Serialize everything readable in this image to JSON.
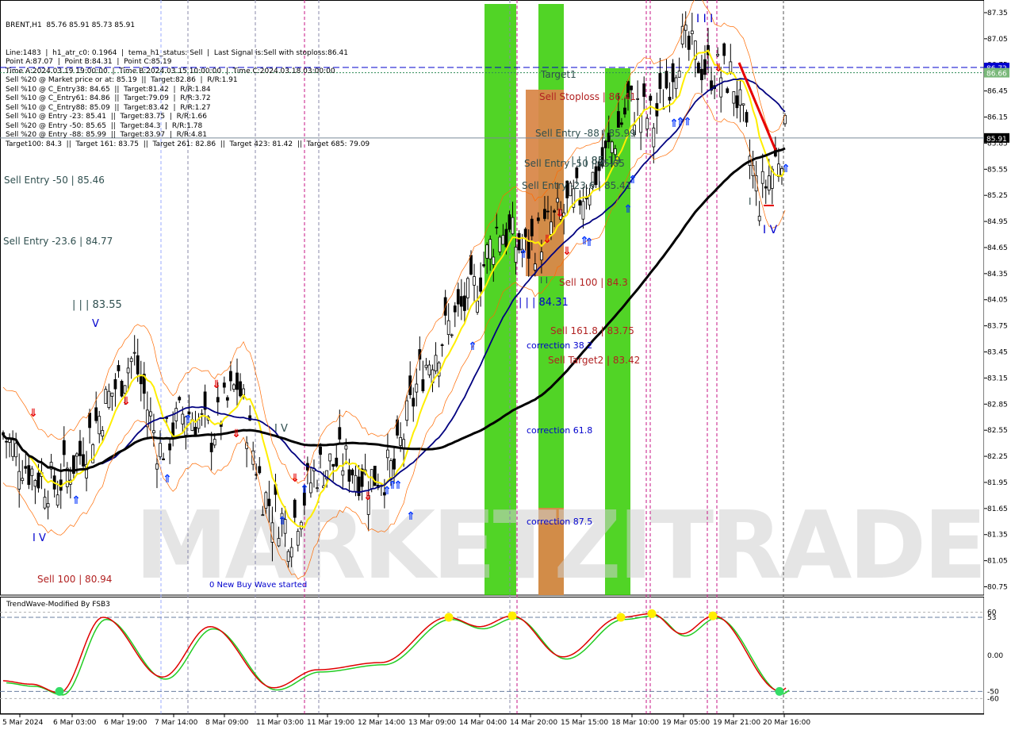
{
  "header": {
    "symbol_line": "BRENT,H1  85.76 85.91 85.73 85.91",
    "info_lines": [
      "Line:1483  |  h1_atr_c0: 0.1964  |  tema_h1_status: Sell  |  Last Signal is:Sell with stoploss:86.41",
      "Point A:87.07  |  Point B:84.31  |  Point C:85.19",
      "Time A:2024.03.19 19:00:00  |  Time B:2024.03.15 10:00:00  |  Time C:2024.03.18 03:00:00",
      "Sell %20 @ Market price or at: 85.19  ||  Target:82.86  |  R/R:1.91",
      "Sell %10 @ C_Entry38: 84.65  ||  Target:81.42  |  R/R:1.84",
      "Sell %10 @ C_Entry61: 84.86  ||  Target:79.09  |  R/R:3.72",
      "Sell %10 @ C_Entry88: 85.09  ||  Target:83.42  |  R/R:1.27",
      "Sell %10 @ Entry -23: 85.41  ||  Target:83.75  |  R/R:1.66",
      "Sell %20 @ Entry -50: 85.65  ||  Target:84.3  |  R/R:1.78",
      "Sell %20 @ Entry -88: 85.99  ||  Target:83.97  |  R/R:4.81",
      "Target100: 84.3  ||  Target 161: 83.75  ||  Target 261: 82.86  ||  Target 423: 81.42  ||  Target 685: 79.09"
    ]
  },
  "watermark": "MARKETZITRADE",
  "indicator_title": "TrendWave-Modified By FSB3",
  "colors": {
    "background": "#ffffff",
    "up_candle": "#000000",
    "yellow_line": "#ffee00",
    "navy_line": "#000080",
    "black_line": "#000000",
    "green_zone": "#33cc00",
    "orange_zone": "#d9884a",
    "label_dark": "#2f4f4f",
    "label_red": "#b22222",
    "label_blue": "#0000cd",
    "red_arrow": "#e60000",
    "blue_arrow": "#0033ff",
    "price_tag_blue": "#0000cd",
    "price_tag_green": "#2e8b57"
  },
  "chart_data": {
    "type": "candlestick",
    "symbol": "BRENT",
    "timeframe": "H1",
    "ylim": [
      80.7,
      87.45
    ],
    "y_ticks": [
      87.35,
      87.05,
      86.75,
      86.45,
      86.15,
      85.85,
      85.55,
      85.25,
      84.95,
      84.65,
      84.35,
      84.05,
      83.75,
      83.45,
      83.15,
      82.85,
      82.55,
      82.25,
      81.95,
      81.65,
      81.35,
      81.05,
      80.75
    ],
    "x_ticks": [
      "5 Mar 2024",
      "6 Mar 03:00",
      "6 Mar 19:00",
      "7 Mar 14:00",
      "8 Mar 09:00",
      "11 Mar 03:00",
      "11 Mar 19:00",
      "12 Mar 14:00",
      "13 Mar 09:00",
      "14 Mar 04:00",
      "14 Mar 20:00",
      "15 Mar 15:00",
      "18 Mar 10:00",
      "19 Mar 05:00",
      "19 Mar 21:00",
      "20 Mar 16:00"
    ],
    "current_price": 85.91,
    "price_tags": [
      {
        "value": "86.72",
        "style": "blue"
      },
      {
        "value": "86.66",
        "style": "green"
      },
      {
        "value": "85.91",
        "style": "black"
      }
    ],
    "zones": [
      {
        "type": "green",
        "from": "14 Mar 04:00",
        "ylow": 80.7,
        "yhigh": 87.45
      },
      {
        "type": "green",
        "from": "14 Mar 20:00",
        "ylow": 80.7,
        "yhigh": 87.45
      },
      {
        "type": "green",
        "from": "18 Mar 10:00",
        "ylow": 80.7,
        "yhigh": 86.7
      }
    ],
    "level_labels": [
      {
        "text": "Target1",
        "value": 86.57,
        "color": "dark"
      },
      {
        "text": "Sell Stoploss | 86.41",
        "value": 86.41,
        "color": "red"
      },
      {
        "text": "Sell Entry -88 | 85.99",
        "value": 85.99,
        "color": "dark"
      },
      {
        "text": "Sell Entry -50 | 85.65",
        "value": 85.65,
        "color": "dark"
      },
      {
        "text": "| | | 85.19",
        "value": 85.74,
        "color": "dark"
      },
      {
        "text": "Sell Entry -23.6 | 85.41",
        "value": 85.41,
        "color": "dark"
      },
      {
        "text": "Sell 100 | 84.3",
        "value": 84.3,
        "color": "red"
      },
      {
        "text": "| | | 84.31",
        "value": 84.05,
        "color": "blue"
      },
      {
        "text": "Sell 161.8 | 83.75",
        "value": 83.75,
        "color": "red"
      },
      {
        "text": "correction 38.2",
        "value": 83.42,
        "color": "blue"
      },
      {
        "text": "Sell Target2 | 83.42",
        "value": 83.42,
        "color": "red"
      },
      {
        "text": "correction 61.8",
        "value": 82.55,
        "color": "blue"
      },
      {
        "text": "correction 87.5",
        "value": 81.6,
        "color": "blue"
      },
      {
        "text": "Sell Entry -50 | 85.46",
        "value": 85.46,
        "color": "dark"
      },
      {
        "text": "Sell Entry -23.6 | 84.77",
        "value": 84.77,
        "color": "dark"
      },
      {
        "text": "| | | 83.55",
        "value": 84.06,
        "color": "dark"
      },
      {
        "text": "V",
        "value": 83.8,
        "color": "blue"
      },
      {
        "text": "I V",
        "value": 81.37,
        "color": "blue"
      },
      {
        "text": "Sell 100 | 80.94",
        "value": 80.94,
        "color": "red"
      },
      {
        "text": "0 New Buy Wave started",
        "value": 80.82,
        "color": "blue"
      },
      {
        "text": "I V",
        "value": 82.56,
        "color": "dark"
      },
      {
        "text": "I I I",
        "value": 87.23,
        "color": "blue"
      },
      {
        "text": "I V",
        "value": 84.68,
        "color": "blue"
      },
      {
        "text": "I",
        "value": 85.35,
        "color": "dark"
      },
      {
        "text": "I I",
        "value": 84.27,
        "color": "dark"
      }
    ],
    "series": [
      {
        "name": "close",
        "points": [
          [
            "5 Mar 2024",
            82.5
          ],
          [
            "5 Mar 2024",
            82.1
          ],
          [
            "6 Mar 03:00",
            81.9
          ],
          [
            "6 Mar 03:00",
            82.3
          ],
          [
            "6 Mar 19:00",
            82.9
          ],
          [
            "6 Mar 19:00",
            83.4
          ],
          [
            "7 Mar 14:00",
            82.3
          ],
          [
            "7 Mar 14:00",
            82.8
          ],
          [
            "8 Mar 09:00",
            82.5
          ],
          [
            "8 Mar 09:00",
            83.1
          ],
          [
            "11 Mar 03:00",
            81.8
          ],
          [
            "11 Mar 03:00",
            81.4
          ],
          [
            "11 Mar 19:00",
            82.1
          ],
          [
            "11 Mar 19:00",
            82.2
          ],
          [
            "12 Mar 14:00",
            82.0
          ],
          [
            "12 Mar 14:00",
            82.1
          ],
          [
            "13 Mar 09:00",
            83.2
          ],
          [
            "13 Mar 09:00",
            83.7
          ],
          [
            "14 Mar 04:00",
            84.1
          ],
          [
            "14 Mar 04:00",
            84.9
          ],
          [
            "14 Mar 20:00",
            84.6
          ],
          [
            "14 Mar 20:00",
            84.9
          ],
          [
            "15 Mar 15:00",
            85.2
          ],
          [
            "15 Mar 15:00",
            85.6
          ],
          [
            "18 Mar 10:00",
            86.3
          ],
          [
            "18 Mar 10:00",
            86.1
          ],
          [
            "19 Mar 05:00",
            87.0
          ],
          [
            "19 Mar 05:00",
            86.7
          ],
          [
            "19 Mar 21:00",
            86.6
          ],
          [
            "19 Mar 21:00",
            85.2
          ],
          [
            "20 Mar 16:00",
            85.91
          ]
        ]
      }
    ],
    "oscillator": {
      "title": "TrendWave-Modified By FSB3",
      "ylim": [
        -75,
        75
      ],
      "y_ticks": [
        60,
        53,
        0.0,
        -50,
        -60
      ],
      "y_tick_labels": [
        "60",
        "53",
        "0.00",
        "-50",
        "-60"
      ]
    }
  }
}
